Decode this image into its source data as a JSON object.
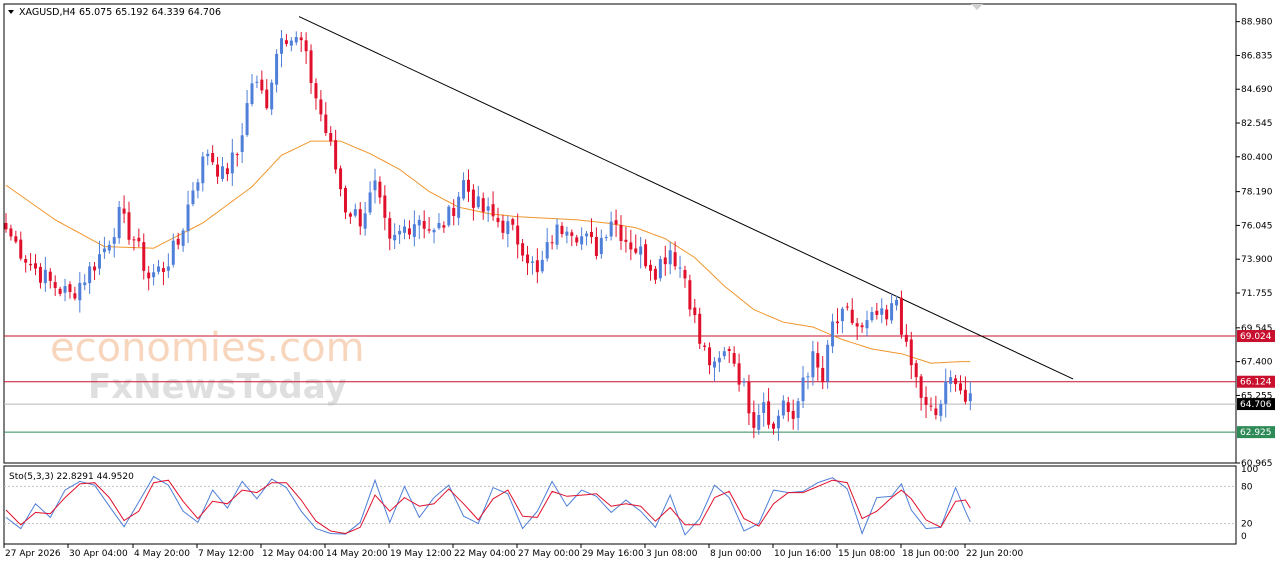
{
  "header": {
    "symbol": "XAGUSD,H4",
    "ohlc": "65.075 65.192 64.339 64.706"
  },
  "oscillator": {
    "label": "Sto(5,3,3) 22.8291 44.9520",
    "ticks": [
      "100",
      "80",
      "20",
      "0"
    ]
  },
  "watermark": {
    "line1": "economies.com",
    "line2": "FxNewsToday"
  },
  "colors": {
    "bull": "#4f7fd8",
    "bear": "#e0102c",
    "ma": "#f0962d",
    "trend": "#000000",
    "resistance": "#c8102e",
    "support": "#2e8b57",
    "current": "#000000",
    "stoch_main": "#4f7fd8",
    "stoch_signal": "#e0102c"
  },
  "chart_data": {
    "type": "candlestick",
    "title": "XAGUSD,H4",
    "ylim": [
      60.965,
      90.1
    ],
    "y_ticks": [
      "88.980",
      "86.835",
      "84.690",
      "82.545",
      "80.400",
      "78.190",
      "76.045",
      "73.900",
      "71.755",
      "69.545",
      "67.400",
      "65.255",
      "60.965"
    ],
    "x_ticks": [
      "27 Apr 2026",
      "30 Apr 04:00",
      "4 May 20:00",
      "7 May 12:00",
      "12 May 04:00",
      "14 May 20:00",
      "19 May 12:00",
      "22 May 04:00",
      "27 May 00:00",
      "29 May 16:00",
      "3 Jun 08:00",
      "8 Jun 00:00",
      "10 Jun 16:00",
      "15 Jun 08:00",
      "18 Jun 00:00",
      "22 Jun 20:00"
    ],
    "levels": [
      {
        "label": "69.024",
        "value": 69.024,
        "kind": "resistance"
      },
      {
        "label": "66.124",
        "value": 66.124,
        "kind": "resistance"
      },
      {
        "label": "64.706",
        "value": 64.706,
        "kind": "current"
      },
      {
        "label": "62.925",
        "value": 62.925,
        "kind": "support"
      }
    ],
    "trendline": {
      "from_price": 89.3,
      "to_price": 66.3
    },
    "close_path": [
      [
        0,
        75.8
      ],
      [
        5,
        73.6
      ],
      [
        9,
        72.4
      ],
      [
        13,
        71.6
      ],
      [
        17,
        73.2
      ],
      [
        20,
        74.6
      ],
      [
        23,
        76.6
      ],
      [
        26,
        75.2
      ],
      [
        29,
        72.8
      ],
      [
        32,
        73.4
      ],
      [
        35,
        74.9
      ],
      [
        38,
        78.5
      ],
      [
        41,
        80.8
      ],
      [
        44,
        79.2
      ],
      [
        47,
        80.6
      ],
      [
        50,
        85.2
      ],
      [
        53,
        84.0
      ],
      [
        56,
        88.5
      ],
      [
        58,
        87.9
      ],
      [
        60,
        87.6
      ],
      [
        63,
        84.2
      ],
      [
        66,
        80.9
      ],
      [
        69,
        77.2
      ],
      [
        72,
        76.5
      ],
      [
        75,
        78.4
      ],
      [
        78,
        74.7
      ],
      [
        81,
        75.9
      ],
      [
        84,
        76.6
      ],
      [
        87,
        75.5
      ],
      [
        90,
        76.6
      ],
      [
        93,
        78.8
      ],
      [
        96,
        77.2
      ],
      [
        99,
        76.5
      ],
      [
        102,
        75.9
      ],
      [
        105,
        74.8
      ],
      [
        108,
        72.8
      ],
      [
        111,
        75.3
      ],
      [
        114,
        76.3
      ],
      [
        117,
        75.3
      ],
      [
        120,
        74.6
      ],
      [
        123,
        76.6
      ],
      [
        126,
        75.2
      ],
      [
        129,
        74.3
      ],
      [
        132,
        73.3
      ],
      [
        135,
        74.6
      ],
      [
        138,
        72.8
      ],
      [
        141,
        68.6
      ],
      [
        144,
        66.8
      ],
      [
        147,
        68.4
      ],
      [
        150,
        65.6
      ],
      [
        152,
        63.8
      ],
      [
        154,
        65.1
      ],
      [
        156,
        63.0
      ],
      [
        158,
        65.1
      ],
      [
        160,
        63.2
      ],
      [
        162,
        66.5
      ],
      [
        164,
        67.5
      ],
      [
        166,
        66.1
      ],
      [
        168,
        69.7
      ],
      [
        171,
        70.3
      ],
      [
        174,
        69.3
      ],
      [
        177,
        70.3
      ],
      [
        179,
        69.9
      ],
      [
        181,
        71.4
      ],
      [
        183,
        68.0
      ],
      [
        185,
        66.2
      ],
      [
        187,
        64.3
      ],
      [
        189,
        64.0
      ],
      [
        191,
        65.6
      ],
      [
        193,
        66.6
      ],
      [
        195,
        64.9
      ],
      [
        196,
        64.7
      ]
    ],
    "ma_path": [
      [
        0,
        78.6
      ],
      [
        10,
        76.4
      ],
      [
        20,
        74.7
      ],
      [
        30,
        74.6
      ],
      [
        40,
        76.2
      ],
      [
        50,
        78.5
      ],
      [
        56,
        80.5
      ],
      [
        62,
        81.4
      ],
      [
        68,
        81.4
      ],
      [
        74,
        80.6
      ],
      [
        80,
        79.6
      ],
      [
        86,
        78.2
      ],
      [
        92,
        77.2
      ],
      [
        98,
        76.8
      ],
      [
        104,
        76.6
      ],
      [
        110,
        76.5
      ],
      [
        116,
        76.4
      ],
      [
        122,
        76.2
      ],
      [
        128,
        75.9
      ],
      [
        134,
        75.2
      ],
      [
        140,
        74.0
      ],
      [
        146,
        72.2
      ],
      [
        152,
        70.7
      ],
      [
        158,
        69.9
      ],
      [
        164,
        69.6
      ],
      [
        170,
        68.8
      ],
      [
        176,
        68.2
      ],
      [
        182,
        67.9
      ],
      [
        188,
        67.3
      ],
      [
        194,
        67.4
      ],
      [
        196,
        67.4
      ]
    ],
    "stochastic": {
      "main_name": "Sto(5,3,3) main",
      "signal_name": "Sto(5,3,3) signal",
      "main_last": 22.8291,
      "signal_last": 44.952,
      "main_path": [
        [
          0,
          30
        ],
        [
          3,
          12
        ],
        [
          6,
          52
        ],
        [
          9,
          30
        ],
        [
          12,
          74
        ],
        [
          15,
          88
        ],
        [
          18,
          82
        ],
        [
          21,
          48
        ],
        [
          24,
          15
        ],
        [
          27,
          55
        ],
        [
          30,
          96
        ],
        [
          33,
          82
        ],
        [
          36,
          40
        ],
        [
          39,
          22
        ],
        [
          42,
          74
        ],
        [
          45,
          45
        ],
        [
          48,
          88
        ],
        [
          51,
          60
        ],
        [
          54,
          92
        ],
        [
          57,
          78
        ],
        [
          60,
          40
        ],
        [
          63,
          12
        ],
        [
          66,
          4
        ],
        [
          69,
          3
        ],
        [
          72,
          22
        ],
        [
          75,
          90
        ],
        [
          78,
          22
        ],
        [
          81,
          80
        ],
        [
          84,
          30
        ],
        [
          87,
          62
        ],
        [
          90,
          82
        ],
        [
          93,
          32
        ],
        [
          96,
          20
        ],
        [
          99,
          78
        ],
        [
          102,
          68
        ],
        [
          105,
          12
        ],
        [
          108,
          40
        ],
        [
          111,
          88
        ],
        [
          114,
          48
        ],
        [
          117,
          74
        ],
        [
          120,
          64
        ],
        [
          123,
          38
        ],
        [
          126,
          58
        ],
        [
          129,
          40
        ],
        [
          132,
          14
        ],
        [
          135,
          66
        ],
        [
          138,
          2
        ],
        [
          141,
          28
        ],
        [
          144,
          82
        ],
        [
          147,
          62
        ],
        [
          150,
          8
        ],
        [
          153,
          20
        ],
        [
          156,
          74
        ],
        [
          159,
          70
        ],
        [
          162,
          72
        ],
        [
          165,
          86
        ],
        [
          168,
          94
        ],
        [
          171,
          76
        ],
        [
          174,
          4
        ],
        [
          177,
          62
        ],
        [
          180,
          64
        ],
        [
          182,
          84
        ],
        [
          184,
          42
        ],
        [
          187,
          12
        ],
        [
          190,
          14
        ],
        [
          193,
          78
        ],
        [
          195,
          40
        ],
        [
          196,
          22.8
        ]
      ],
      "signal_path": [
        [
          0,
          42
        ],
        [
          3,
          18
        ],
        [
          6,
          38
        ],
        [
          9,
          36
        ],
        [
          12,
          62
        ],
        [
          15,
          84
        ],
        [
          18,
          86
        ],
        [
          21,
          62
        ],
        [
          24,
          25
        ],
        [
          27,
          40
        ],
        [
          30,
          86
        ],
        [
          33,
          90
        ],
        [
          36,
          56
        ],
        [
          39,
          28
        ],
        [
          42,
          56
        ],
        [
          45,
          52
        ],
        [
          48,
          74
        ],
        [
          51,
          70
        ],
        [
          54,
          86
        ],
        [
          57,
          86
        ],
        [
          60,
          58
        ],
        [
          63,
          24
        ],
        [
          66,
          8
        ],
        [
          69,
          4
        ],
        [
          72,
          14
        ],
        [
          75,
          66
        ],
        [
          78,
          40
        ],
        [
          81,
          62
        ],
        [
          84,
          48
        ],
        [
          87,
          52
        ],
        [
          90,
          76
        ],
        [
          93,
          52
        ],
        [
          96,
          26
        ],
        [
          99,
          60
        ],
        [
          102,
          74
        ],
        [
          105,
          32
        ],
        [
          108,
          30
        ],
        [
          111,
          72
        ],
        [
          114,
          64
        ],
        [
          117,
          66
        ],
        [
          120,
          68
        ],
        [
          123,
          48
        ],
        [
          126,
          52
        ],
        [
          129,
          48
        ],
        [
          132,
          24
        ],
        [
          135,
          46
        ],
        [
          138,
          18
        ],
        [
          141,
          18
        ],
        [
          144,
          62
        ],
        [
          147,
          72
        ],
        [
          150,
          28
        ],
        [
          153,
          16
        ],
        [
          156,
          52
        ],
        [
          159,
          70
        ],
        [
          162,
          70
        ],
        [
          165,
          80
        ],
        [
          168,
          90
        ],
        [
          171,
          86
        ],
        [
          174,
          28
        ],
        [
          177,
          40
        ],
        [
          180,
          62
        ],
        [
          182,
          74
        ],
        [
          184,
          60
        ],
        [
          187,
          26
        ],
        [
          190,
          14
        ],
        [
          193,
          56
        ],
        [
          195,
          58
        ],
        [
          196,
          45
        ]
      ]
    }
  }
}
